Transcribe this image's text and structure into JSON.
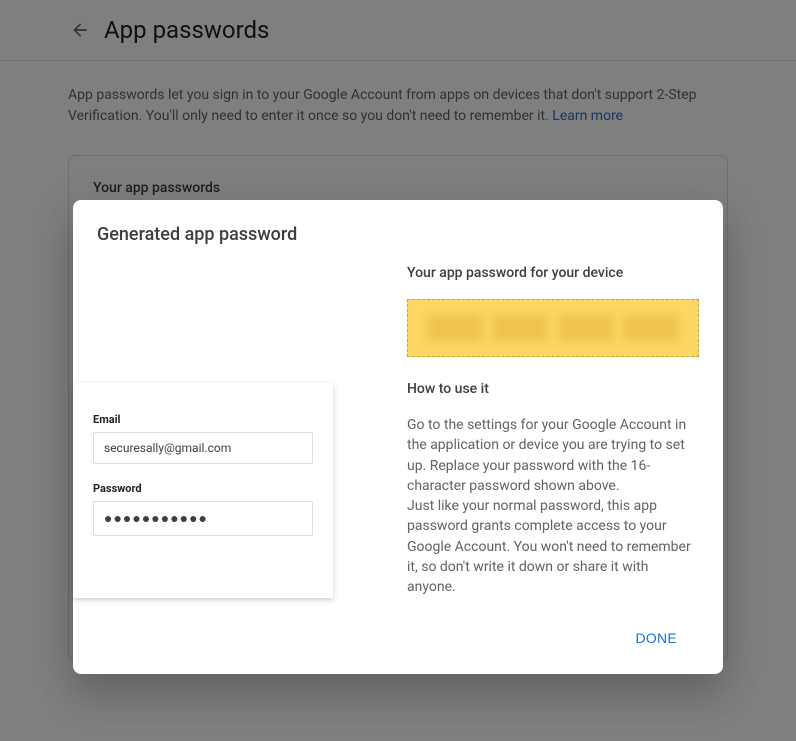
{
  "header": {
    "title": "App passwords"
  },
  "description": {
    "text": "App passwords let you sign in to your Google Account from apps on devices that don't support 2-Step Verification. You'll only need to enter it once so you don't need to remember it. ",
    "learn_more": "Learn more"
  },
  "card": {
    "title": "Your app passwords"
  },
  "modal": {
    "title": "Generated app password",
    "device_preview": {
      "email_label": "Email",
      "email_value": "securesally@gmail.com",
      "password_label": "Password",
      "password_value": "●●●●●●●●●●●"
    },
    "right": {
      "subtitle": "Your app password for your device",
      "how_title": "How to use it",
      "how_text": "Go to the settings for your Google Account in the application or device you are trying to set up. Replace your password with the 16-character password shown above.\nJust like your normal password, this app password grants complete access to your Google Account. You won't need to remember it, so don't write it down or share it with anyone."
    },
    "done_label": "DONE"
  }
}
